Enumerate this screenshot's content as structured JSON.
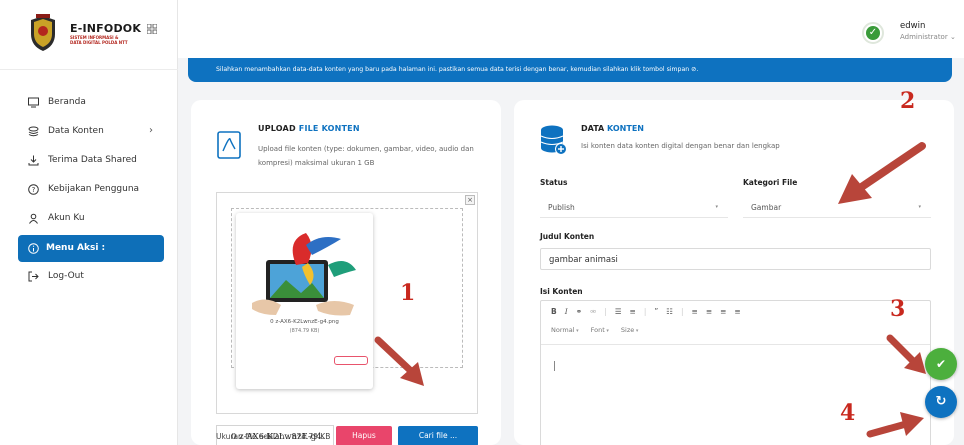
{
  "app": {
    "logo_title": "E-INFODOK",
    "logo_subtitle": "SISTEM INFORMASI & DATA DIGITAL POLDA NTT"
  },
  "sidebar": {
    "items": [
      {
        "label": "Beranda",
        "icon": "monitor-icon"
      },
      {
        "label": "Data Konten",
        "icon": "layers-icon",
        "has_chevron": true,
        "chevron": "›"
      },
      {
        "label": "Terima Data Shared",
        "icon": "download-icon"
      },
      {
        "label": "Kebijakan Pengguna",
        "icon": "help-circle-icon"
      },
      {
        "label": "Akun Ku",
        "icon": "user-icon"
      },
      {
        "label": "Menu Aksi :",
        "icon": "info-circle-icon",
        "active": true
      },
      {
        "label": "Log-Out",
        "icon": "logout-icon"
      }
    ]
  },
  "header": {
    "user_name": "edwin",
    "user_role": "Administrator ⌄",
    "status_check": "✓"
  },
  "banner": {
    "text": "Silahkan menambahkan data-data konten yang baru pada halaman ini. pastikan semua data terisi dengan benar, kemudian silahkan klik tombol simpan ⊘."
  },
  "upload": {
    "title_plain": "UPLOAD ",
    "title_accent": "FILE KONTEN",
    "description": "Upload file konten (type: dokumen, gambar, video, audio dan kompresi) maksimal ukuran 1 GB",
    "close_glyph": "×",
    "preview_file_name": "0 z-AX6-K2LwnzE-g4.png",
    "preview_file_size": "(874.79 KB)",
    "file_name_value": "0 z-AX6-K2LwnzE-g4.",
    "hapus_label": "Hapus",
    "cari_label": "Cari file ...",
    "file_size_text": "Ukuran file adalah : 874.79 KB"
  },
  "data_konten": {
    "title_plain": "DATA ",
    "title_accent": "KONTEN",
    "description": "Isi konten data konten digital dengan benar dan lengkap",
    "status_label": "Status",
    "status_value": "Publish",
    "kategori_label": "Kategori File",
    "kategori_value": "Gambar",
    "select_caret": "▾",
    "judul_label": "Judul Konten",
    "judul_value": "gambar animasi",
    "isi_label": "Isi Konten",
    "toolbar_row1": [
      "B",
      "I",
      "⚭",
      "⚮",
      "|",
      "☰",
      "≡",
      "|",
      "”",
      "☷",
      "|",
      "≡",
      "≡",
      "≡",
      "≡"
    ],
    "format_dropdowns": [
      "Normal",
      "Font",
      "Size"
    ]
  },
  "fab": {
    "save_glyph": "✔",
    "reset_glyph": "↻"
  },
  "annotations": [
    "1",
    "2",
    "3",
    "4"
  ],
  "colors": {
    "primary": "#0e72c0",
    "danger": "#e9456b",
    "success": "#4caf3d",
    "annotation": "#c8281e"
  }
}
